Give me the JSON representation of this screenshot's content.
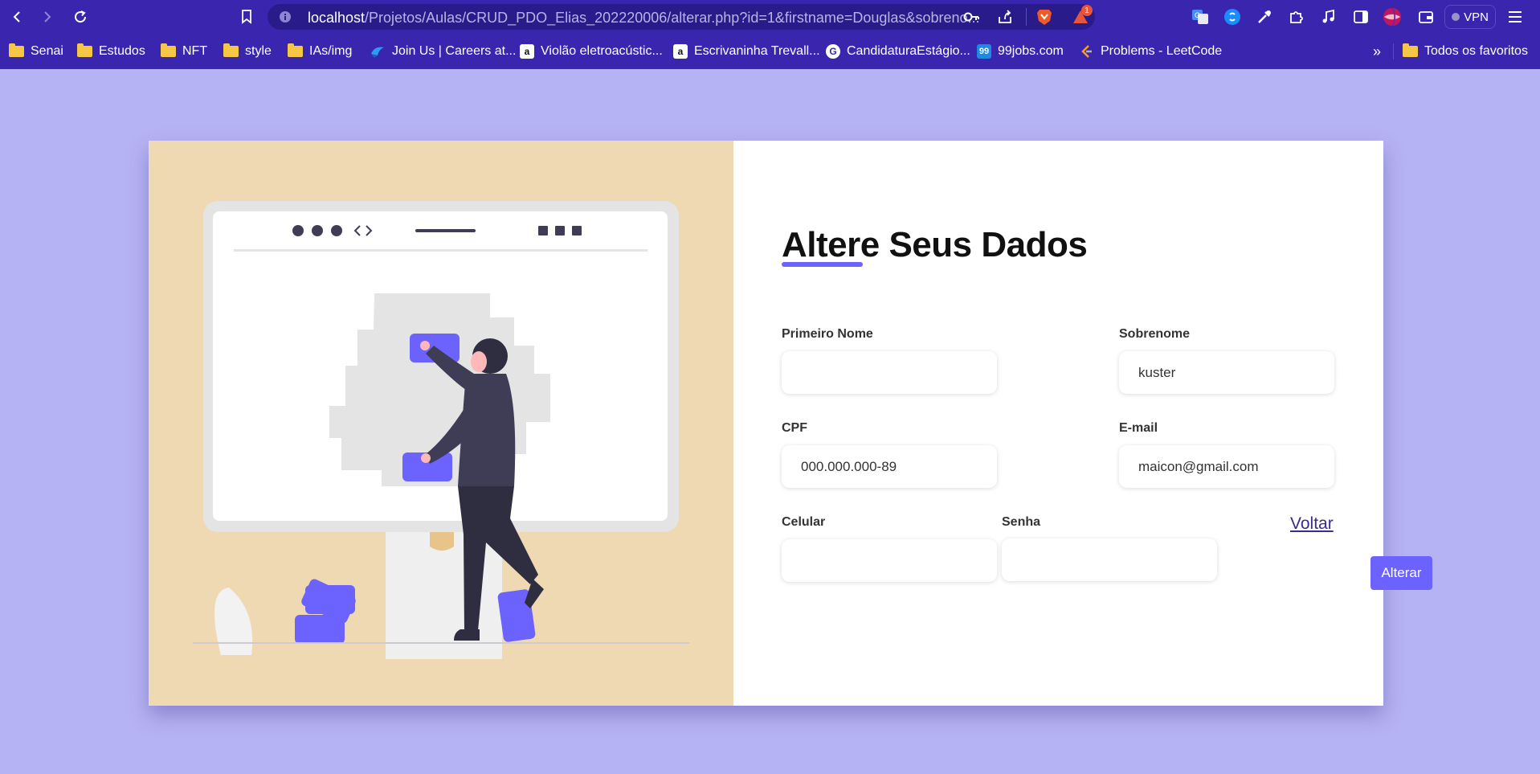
{
  "browser": {
    "url_host": "localhost",
    "url_path": "/Projetos/Aulas/CRUD_PDO_Elias_202220006/alterar.php?id=1&firstname=Douglas&sobreno...",
    "notification_count": "1",
    "vpn_label": "VPN"
  },
  "bookmarks": [
    {
      "label": "Senai",
      "icon": "folder-icon"
    },
    {
      "label": "Estudos",
      "icon": "folder-icon"
    },
    {
      "label": "NFT",
      "icon": "folder-icon"
    },
    {
      "label": "style",
      "icon": "folder-icon"
    },
    {
      "label": "IAs/img",
      "icon": "folder-icon"
    },
    {
      "label": "Join Us | Careers at...",
      "icon": "join-us-favicon"
    },
    {
      "label": "Violão eletroacústic...",
      "icon": "amazon-icon"
    },
    {
      "label": "Escrivaninha Trevall...",
      "icon": "amazon-icon"
    },
    {
      "label": "CandidaturaEstágio...",
      "icon": "candidatura-favicon"
    },
    {
      "label": "99jobs.com",
      "icon": "99jobs-favicon"
    },
    {
      "label": "Problems - LeetCode",
      "icon": "leetcode-icon"
    }
  ],
  "bookmarks_more": "»",
  "all_favorites": "Todos os favoritos",
  "form": {
    "title": "Altere Seus Dados",
    "fields": {
      "first_name": {
        "label": "Primeiro Nome",
        "value": ""
      },
      "last_name": {
        "label": "Sobrenome",
        "value": "kuster"
      },
      "cpf": {
        "label": "CPF",
        "value": "000.000.000-89"
      },
      "email": {
        "label": "E-mail",
        "value": "maicon@gmail.com"
      },
      "phone": {
        "label": "Celular",
        "value": ""
      },
      "password": {
        "label": "Senha",
        "value": ""
      }
    },
    "back_link": "Voltar",
    "submit_label": "Alterar"
  },
  "colors": {
    "accent": "#6c63ff",
    "browser_bar": "#3a26ae",
    "page_bg": "#b6b3f4",
    "illustration_bg": "#efd9b3"
  }
}
